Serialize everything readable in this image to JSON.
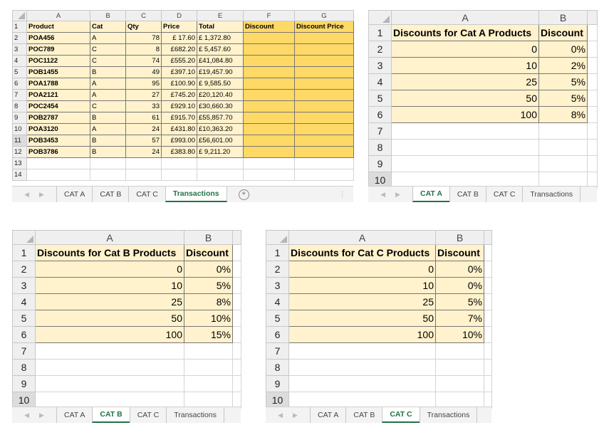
{
  "transactions": {
    "columns": [
      "A",
      "B",
      "C",
      "D",
      "E",
      "F",
      "G"
    ],
    "row_numbers": [
      "1",
      "2",
      "3",
      "4",
      "5",
      "6",
      "7",
      "8",
      "9",
      "10",
      "11",
      "12",
      "13",
      "14"
    ],
    "headers": [
      "Product",
      "Cat",
      "Qty",
      "Price",
      "Total",
      "Discount",
      "Discount Price"
    ],
    "rows": [
      [
        "POA456",
        "A",
        "78",
        "£ 17.60",
        "£ 1,372.80",
        "",
        ""
      ],
      [
        "POC789",
        "C",
        "8",
        "£682.20",
        "£ 5,457.60",
        "",
        ""
      ],
      [
        "POC1122",
        "C",
        "74",
        "£555.20",
        "£41,084.80",
        "",
        ""
      ],
      [
        "POB1455",
        "B",
        "49",
        "£397.10",
        "£19,457.90",
        "",
        ""
      ],
      [
        "POA1788",
        "A",
        "95",
        "£100.90",
        "£ 9,585.50",
        "",
        ""
      ],
      [
        "POA2121",
        "A",
        "27",
        "£745.20",
        "£20,120.40",
        "",
        ""
      ],
      [
        "POC2454",
        "C",
        "33",
        "£929.10",
        "£30,660.30",
        "",
        ""
      ],
      [
        "POB2787",
        "B",
        "61",
        "£915.70",
        "£55,857.70",
        "",
        ""
      ],
      [
        "POA3120",
        "A",
        "24",
        "£431.80",
        "£10,363.20",
        "",
        ""
      ],
      [
        "POB3453",
        "B",
        "57",
        "£993.00",
        "£56,601.00",
        "",
        ""
      ],
      [
        "POB3786",
        "B",
        "24",
        "£383.80",
        "£ 9,211.20",
        "",
        ""
      ]
    ],
    "tabs": [
      "CAT A",
      "CAT B",
      "CAT C",
      "Transactions"
    ],
    "active_tab": "Transactions"
  },
  "cat_a": {
    "columns": [
      "A",
      "B"
    ],
    "row_numbers": [
      "1",
      "2",
      "3",
      "4",
      "5",
      "6",
      "7",
      "8",
      "9",
      "10"
    ],
    "header": [
      "Discounts for Cat A Products",
      "Discount"
    ],
    "rows": [
      [
        "0",
        "0%"
      ],
      [
        "10",
        "2%"
      ],
      [
        "25",
        "5%"
      ],
      [
        "50",
        "5%"
      ],
      [
        "100",
        "8%"
      ]
    ],
    "tabs": [
      "CAT A",
      "CAT B",
      "CAT C",
      "Transactions"
    ],
    "active_tab": "CAT A"
  },
  "cat_b": {
    "columns": [
      "A",
      "B"
    ],
    "row_numbers": [
      "1",
      "2",
      "3",
      "4",
      "5",
      "6",
      "7",
      "8",
      "9",
      "10"
    ],
    "header": [
      "Discounts for Cat B Products",
      "Discount"
    ],
    "rows": [
      [
        "0",
        "0%"
      ],
      [
        "10",
        "5%"
      ],
      [
        "25",
        "8%"
      ],
      [
        "50",
        "10%"
      ],
      [
        "100",
        "15%"
      ]
    ],
    "tabs": [
      "CAT A",
      "CAT B",
      "CAT C",
      "Transactions"
    ],
    "active_tab": "CAT B"
  },
  "cat_c": {
    "columns": [
      "A",
      "B"
    ],
    "row_numbers": [
      "1",
      "2",
      "3",
      "4",
      "5",
      "6",
      "7",
      "8",
      "9",
      "10"
    ],
    "header": [
      "Discounts for Cat C Products",
      "Discount"
    ],
    "rows": [
      [
        "0",
        "0%"
      ],
      [
        "10",
        "0%"
      ],
      [
        "25",
        "5%"
      ],
      [
        "50",
        "7%"
      ],
      [
        "100",
        "10%"
      ]
    ],
    "tabs": [
      "CAT A",
      "CAT B",
      "CAT C",
      "Transactions"
    ],
    "active_tab": "CAT C"
  },
  "colors": {
    "fill_light": "#fff2cc",
    "fill_gold": "#ffd966",
    "active_tab": "#217346"
  },
  "icons": {
    "nav_prev": "chevron-left-icon",
    "nav_next": "chevron-right-icon",
    "add_sheet": "plus-circle-icon",
    "more": "more-vertical-icon"
  }
}
